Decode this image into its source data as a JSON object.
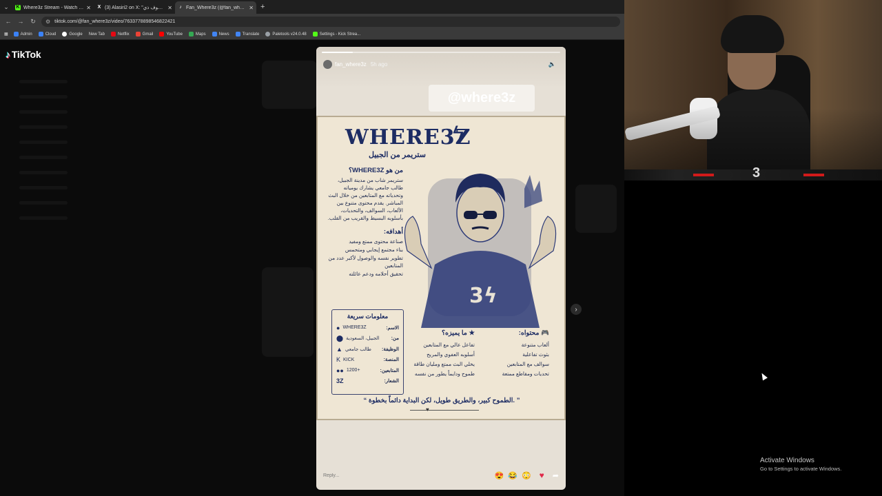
{
  "browser": {
    "tabs": [
      {
        "title": "Where3z Stream - Watch Live o",
        "icon": "kick-icon",
        "color": "#53fc18",
        "active": false
      },
      {
        "title": "(3) Alasiri2 on X: \"تقيب شوف ذي\"",
        "icon": "x-icon",
        "color": "#ffffff",
        "active": false
      },
      {
        "title": "Fan_Where3z (@fan_where3z) |",
        "icon": "tiktok-icon",
        "color": "#ffffff",
        "active": true
      }
    ],
    "url": "tiktok.com/@fan_where3z/video/7633778898546822421",
    "bookmarks": [
      {
        "label": "Admin",
        "color": "#3b82f6"
      },
      {
        "label": "Cloud",
        "color": "#3b82f6"
      },
      {
        "label": "Google",
        "color": "#ffffff"
      },
      {
        "label": "New Tab",
        "color": "#3a3a3a"
      },
      {
        "label": "Netflix",
        "color": "#e50914"
      },
      {
        "label": "Gmail",
        "color": "#ea4335"
      },
      {
        "label": "YouTube",
        "color": "#ff0000"
      },
      {
        "label": "Maps",
        "color": "#34a853"
      },
      {
        "label": "News",
        "color": "#4285f4"
      },
      {
        "label": "Translate",
        "color": "#4285f4"
      },
      {
        "label": "Paletools v24.0.48",
        "color": "#9aa0a6"
      },
      {
        "label": "Settings - Kick Strea...",
        "color": "#53fc18"
      }
    ]
  },
  "tiktok": {
    "logo": "TikTok",
    "story": {
      "username": "fan_where3z",
      "time": "5h ago",
      "progress": 0.13,
      "mention": "@where3z",
      "reply_placeholder": "Reply...",
      "emojis": [
        "😍",
        "😂",
        "😳"
      ]
    },
    "poster": {
      "title": "WHERE3Z",
      "subtitle": "ستريمر من الجبيل",
      "who_title": "من هو WHERE3Z؟",
      "who_text": "ستريمر شاب من مدينة الجبيل، طالب جامعي يشارك يومياته وتحدياته مع المتابعين من خلال البث المباشر. يقدم محتوى متنوع بين الألعاب، السوالف، والتحديات، بأسلوبه البسيط والقريب من القلب.",
      "goals_title": "أهدافه:",
      "goals": [
        "صناعة محتوى ممتع ومفيد",
        "بناء مجتمع إيجابي ومتحمس",
        "تطوير نفسه والوصول لأكبر عدد من المتابعين",
        "تحقيق أحلامه ودعم عائلته"
      ],
      "info_title": "معلومات سريعة",
      "info": [
        {
          "k": "الاسم:",
          "v": "WHERE3Z",
          "icon": "user-icon"
        },
        {
          "k": "من:",
          "v": "الجبيل، السعودية",
          "icon": "pin-icon"
        },
        {
          "k": "الوظيفة:",
          "v": "طالب جامعي",
          "icon": "cap-icon"
        },
        {
          "k": "المنصة:",
          "v": "KICK",
          "icon": "kick-icon"
        },
        {
          "k": "المتابعين:",
          "v": "1200+",
          "icon": "users-icon"
        },
        {
          "k": "الشعار:",
          "v": "3Z",
          "icon": "logo-icon"
        }
      ],
      "special_title": "ما يميزه؟",
      "special": [
        "تفاعل عالي مع المتابعين",
        "أسلوبه العفوي والمريح",
        "يخلي البث ممتع ومليان طاقة",
        "طموح ودايماً يطور من نفسه"
      ],
      "content_title": "محتواه:",
      "content": [
        "ألعاب متنوعة",
        "بثوث تفاعلية",
        "سوالف مع المتابعين",
        "تحديات ومقاطع ممتعة"
      ],
      "quote": "الطموح كبير، والطريق طويل، لكن البداية دائماً بخطوة."
    }
  },
  "overlay": {
    "activate_title": "Activate Windows",
    "activate_sub": "Go to Settings to activate Windows."
  }
}
